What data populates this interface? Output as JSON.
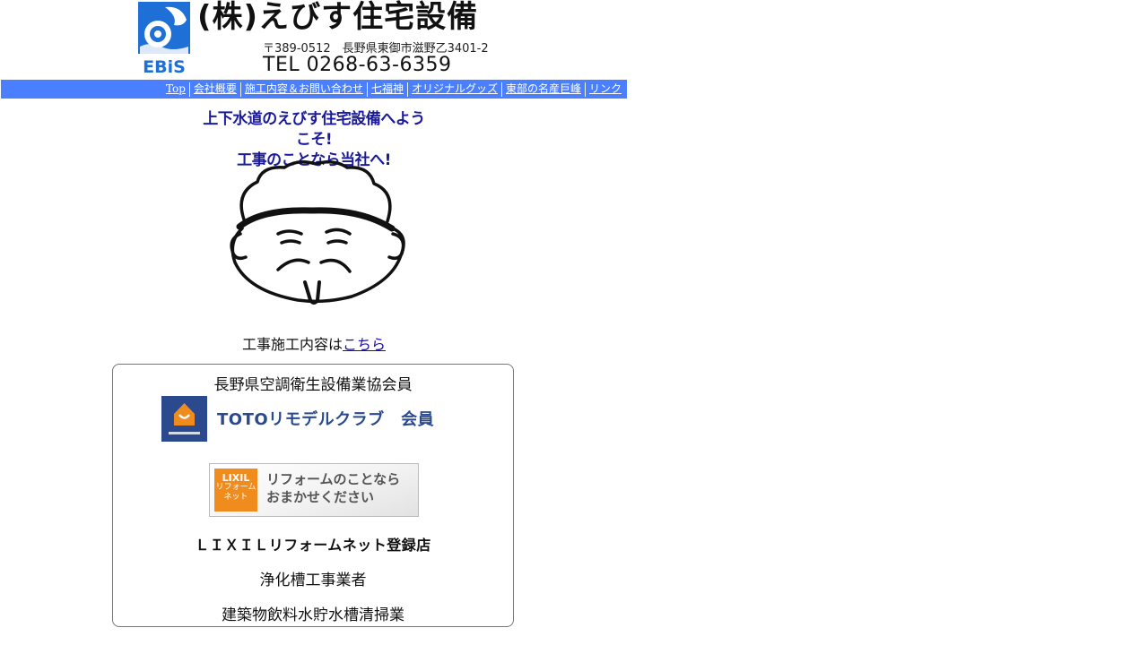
{
  "header": {
    "company_name": "(株)えびす住宅設備",
    "address": "〒389-0512　長野県東御市滋野乙3401-2",
    "tel": "TEL 0268-63-6359",
    "logo_text": "EBiS",
    "logo_color": "#1e6fd6"
  },
  "nav": {
    "background": "#4a7fff",
    "items": [
      {
        "label": "Top"
      },
      {
        "label": "会社概要"
      },
      {
        "label": "施工内容＆お問い合わせ"
      },
      {
        "label": "七福神"
      },
      {
        "label": "オリジナルグッズ"
      },
      {
        "label": "東部の名産巨峰"
      },
      {
        "label": "リンク"
      }
    ]
  },
  "welcome": {
    "line1": "上下水道のえびす住宅設備へようこそ!",
    "line2": "工事のことなら当社へ!"
  },
  "works": {
    "prefix": "工事施工内容は",
    "link": "こちら"
  },
  "members": {
    "association": "長野県空調衛生設備業協会員",
    "toto_text": "TOTOリモデルクラブ　会員",
    "toto_color": "#2b4a8e",
    "lixil_logo_line1": "LIXIL",
    "lixil_logo_line2": "リフォーム",
    "lixil_logo_line3": "ネット",
    "lixil_line1": "リフォームのことなら",
    "lixil_line2": "おまかせください",
    "lixil_registered": "ＬＩＸＩＬリフォームネット登録店",
    "septic": "浄化槽工事業者",
    "watertank": "建築物飲料水貯水槽清掃業"
  }
}
